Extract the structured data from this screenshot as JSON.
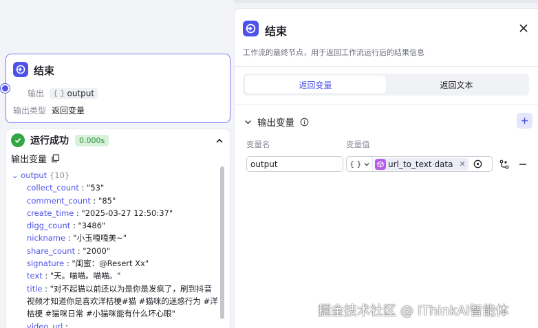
{
  "node": {
    "title": "结束",
    "output_label": "输出",
    "output_brace": "{ }",
    "output_name": "output",
    "type_label": "输出类型",
    "type_value": "返回变量"
  },
  "run": {
    "title": "运行成功",
    "time": "0.000s",
    "output_title": "输出变量",
    "root_key": "output",
    "root_count": "{10}",
    "fields": [
      {
        "key": "collect_count",
        "value": "\"53\""
      },
      {
        "key": "comment_count",
        "value": "\"85\""
      },
      {
        "key": "create_time",
        "value": "\"2025-03-27 12:50:37\""
      },
      {
        "key": "digg_count",
        "value": "\"3486\""
      },
      {
        "key": "nickname",
        "value": "\"小玉嘎嘎美~\""
      },
      {
        "key": "share_count",
        "value": "\"2000\""
      },
      {
        "key": "signature",
        "value": "\"闺蜜：@Resert Xx\""
      },
      {
        "key": "text",
        "value": "\"天。喵喵。喵喵。\""
      },
      {
        "key": "title",
        "value": "\"对不起猫以前还以为是你是发疯了，刷到抖音视频才知道你是喜欢洋桔梗#猫 #猫咪的迷惑行为 #洋桔梗 #猫咪日常 #小猫咪能有什么坏心眼\""
      },
      {
        "key": "video_url",
        "value": ""
      }
    ]
  },
  "panel": {
    "title": "结束",
    "description": "工作流的最终节点，用于返回工作流运行后的结果信息",
    "tab_return_var": "返回变量",
    "tab_return_text": "返回文本",
    "section_title": "输出变量",
    "col_name": "变量名",
    "col_value": "变量值",
    "row_name": "output",
    "row_type": "{ }",
    "row_ref_node": "url_to_text",
    "row_ref_sep": " · ",
    "row_ref_field": "data"
  },
  "watermark": "掘金技术社区 @ iThinkAi智能体",
  "colors": {
    "accent": "#4d53e8",
    "success": "#32a645",
    "plugin": "#b85ee6"
  }
}
